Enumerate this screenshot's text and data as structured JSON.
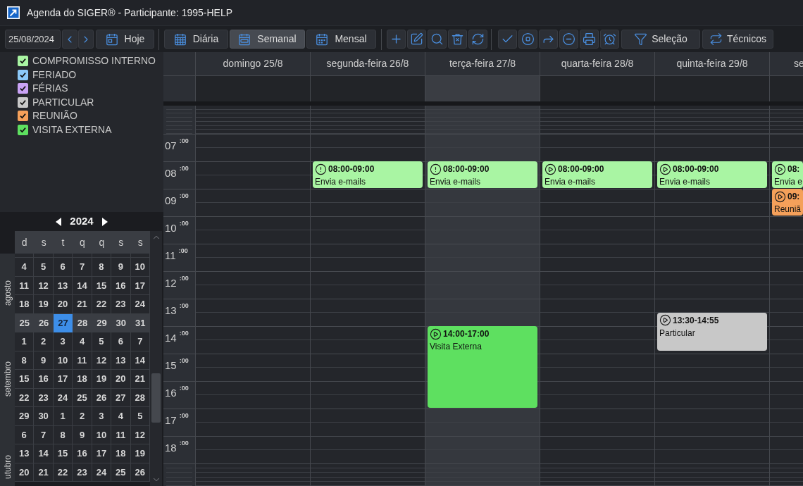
{
  "window": {
    "title": "Agenda do SIGER® - Participante: 1995-HELP"
  },
  "toolbar": {
    "date": "25/08/2024",
    "today_button": "Hoje",
    "views": [
      {
        "label": "Diária",
        "selected": false
      },
      {
        "label": "Semanal",
        "selected": true
      },
      {
        "label": "Mensal",
        "selected": false
      }
    ],
    "filters": [
      "Seleção",
      "Técnicos"
    ]
  },
  "legend": [
    {
      "label": "COMPROMISSO INTERNO",
      "color": "#a9f5a3",
      "checked": true
    },
    {
      "label": "FERIADO",
      "color": "#8cc8f8",
      "checked": true
    },
    {
      "label": "FÉRIAS",
      "color": "#c9a2f5",
      "checked": true
    },
    {
      "label": "PARTICULAR",
      "color": "#c8c8c8",
      "checked": true
    },
    {
      "label": "REUNIÃO",
      "color": "#f5a05a",
      "checked": true
    },
    {
      "label": "VISITA EXTERNA",
      "color": "#5ee060",
      "checked": true
    }
  ],
  "mini_calendar": {
    "year": "2024",
    "weekdays": [
      "d",
      "s",
      "t",
      "q",
      "q",
      "s",
      "s"
    ],
    "months": [
      {
        "label": "agosto",
        "weeks": [
          {
            "selected": false,
            "days": [
              {
                "label": "4",
                "today": false
              },
              {
                "label": "5",
                "today": false
              },
              {
                "label": "6",
                "today": false
              },
              {
                "label": "7",
                "today": false
              },
              {
                "label": "8",
                "today": false
              },
              {
                "label": "9",
                "today": false
              },
              {
                "label": "10",
                "today": false
              }
            ]
          },
          {
            "selected": false,
            "days": [
              {
                "label": "11",
                "today": false
              },
              {
                "label": "12",
                "today": false
              },
              {
                "label": "13",
                "today": false
              },
              {
                "label": "14",
                "today": false
              },
              {
                "label": "15",
                "today": false
              },
              {
                "label": "16",
                "today": false
              },
              {
                "label": "17",
                "today": false
              }
            ]
          },
          {
            "selected": false,
            "days": [
              {
                "label": "18",
                "today": false
              },
              {
                "label": "19",
                "today": false
              },
              {
                "label": "20",
                "today": false
              },
              {
                "label": "21",
                "today": false
              },
              {
                "label": "22",
                "today": false
              },
              {
                "label": "23",
                "today": false
              },
              {
                "label": "24",
                "today": false
              }
            ]
          },
          {
            "selected": true,
            "days": [
              {
                "label": "25",
                "today": false
              },
              {
                "label": "26",
                "today": false
              },
              {
                "label": "27",
                "today": true
              },
              {
                "label": "28",
                "today": false
              },
              {
                "label": "29",
                "today": false
              },
              {
                "label": "30",
                "today": false
              },
              {
                "label": "31",
                "today": false
              }
            ]
          }
        ]
      },
      {
        "label": "setembro",
        "weeks": [
          {
            "selected": false,
            "days": [
              {
                "label": "1",
                "today": false
              },
              {
                "label": "2",
                "today": false
              },
              {
                "label": "3",
                "today": false
              },
              {
                "label": "4",
                "today": false
              },
              {
                "label": "5",
                "today": false
              },
              {
                "label": "6",
                "today": false
              },
              {
                "label": "7",
                "today": false
              }
            ]
          },
          {
            "selected": false,
            "days": [
              {
                "label": "8",
                "today": false
              },
              {
                "label": "9",
                "today": false
              },
              {
                "label": "10",
                "today": false
              },
              {
                "label": "11",
                "today": false
              },
              {
                "label": "12",
                "today": false
              },
              {
                "label": "13",
                "today": false
              },
              {
                "label": "14",
                "today": false
              }
            ]
          },
          {
            "selected": false,
            "days": [
              {
                "label": "15",
                "today": false
              },
              {
                "label": "16",
                "today": false
              },
              {
                "label": "17",
                "today": false
              },
              {
                "label": "18",
                "today": false
              },
              {
                "label": "19",
                "today": false
              },
              {
                "label": "20",
                "today": false
              },
              {
                "label": "21",
                "today": false
              }
            ]
          },
          {
            "selected": false,
            "days": [
              {
                "label": "22",
                "today": false
              },
              {
                "label": "23",
                "today": false
              },
              {
                "label": "24",
                "today": false
              },
              {
                "label": "25",
                "today": false
              },
              {
                "label": "26",
                "today": false
              },
              {
                "label": "27",
                "today": false
              },
              {
                "label": "28",
                "today": false
              }
            ]
          },
          {
            "selected": false,
            "days": [
              {
                "label": "29",
                "today": false
              },
              {
                "label": "30",
                "today": false
              },
              {
                "label": "1",
                "today": false
              },
              {
                "label": "2",
                "today": false
              },
              {
                "label": "3",
                "today": false
              },
              {
                "label": "4",
                "today": false
              },
              {
                "label": "5",
                "today": false
              }
            ]
          }
        ]
      },
      {
        "label": "utubro",
        "weeks": [
          {
            "selected": false,
            "days": [
              {
                "label": "6",
                "today": false
              },
              {
                "label": "7",
                "today": false
              },
              {
                "label": "8",
                "today": false
              },
              {
                "label": "9",
                "today": false
              },
              {
                "label": "10",
                "today": false
              },
              {
                "label": "11",
                "today": false
              },
              {
                "label": "12",
                "today": false
              }
            ]
          },
          {
            "selected": false,
            "days": [
              {
                "label": "13",
                "today": false
              },
              {
                "label": "14",
                "today": false
              },
              {
                "label": "15",
                "today": false
              },
              {
                "label": "16",
                "today": false
              },
              {
                "label": "17",
                "today": false
              },
              {
                "label": "18",
                "today": false
              },
              {
                "label": "19",
                "today": false
              }
            ]
          },
          {
            "selected": false,
            "days": [
              {
                "label": "20",
                "today": false
              },
              {
                "label": "21",
                "today": false
              },
              {
                "label": "22",
                "today": false
              },
              {
                "label": "23",
                "today": false
              },
              {
                "label": "24",
                "today": false
              },
              {
                "label": "25",
                "today": false
              },
              {
                "label": "26",
                "today": false
              }
            ]
          }
        ]
      }
    ]
  },
  "week_view": {
    "hours": [
      "07 $^{:00}$",
      "08 $^{:00}$",
      "09 $^{:00}$",
      "10 $^{:00}$",
      "11 $^{:00}$",
      "12 $^{:00}$",
      "13 $^{:00}$",
      "14 $^{:00}$",
      "15 $^{:00}$",
      "16 $^{:00}$",
      "17 $^{:00}$",
      "18 $^{:00}$"
    ],
    "days": [
      {
        "label": "domingo 25/8",
        "today": false
      },
      {
        "label": "segunda-feira 26/8",
        "today": false,
        "events": [
          {
            "time": "08:00-09:00",
            "title": "Envia e-mails",
            "kind": "alert",
            "color": "#a9f5a3"
          }
        ]
      },
      {
        "label": "terça-feira 27/8",
        "today": true,
        "events": [
          {
            "time": "08:00-09:00",
            "title": "Envia e-mails",
            "kind": "alert",
            "color": "#a9f5a3"
          },
          {
            "time": "14:00-17:00",
            "title": "Visita Externa",
            "kind": "play",
            "color": "#5ee060"
          }
        ]
      },
      {
        "label": "quarta-feira 28/8",
        "today": false,
        "events": [
          {
            "time": "08:00-09:00",
            "title": "Envia e-mails",
            "kind": "play",
            "color": "#a9f5a3"
          }
        ]
      },
      {
        "label": "quinta-feira 29/8",
        "today": false,
        "events": [
          {
            "time": "08:00-09:00",
            "title": "Envia e-mails",
            "kind": "play",
            "color": "#a9f5a3"
          },
          {
            "time": "13:30-14:55",
            "title": "Particular",
            "kind": "play",
            "color": "#c8c8c8"
          }
        ]
      },
      {
        "label": "se",
        "today": false,
        "events": [
          {
            "time": "08:",
            "title": "Envia e",
            "kind": "play",
            "color": "#a9f5a3"
          },
          {
            "time": "09:",
            "title": "Reuniã",
            "kind": "play",
            "color": "#f5a05a"
          }
        ]
      }
    ]
  }
}
